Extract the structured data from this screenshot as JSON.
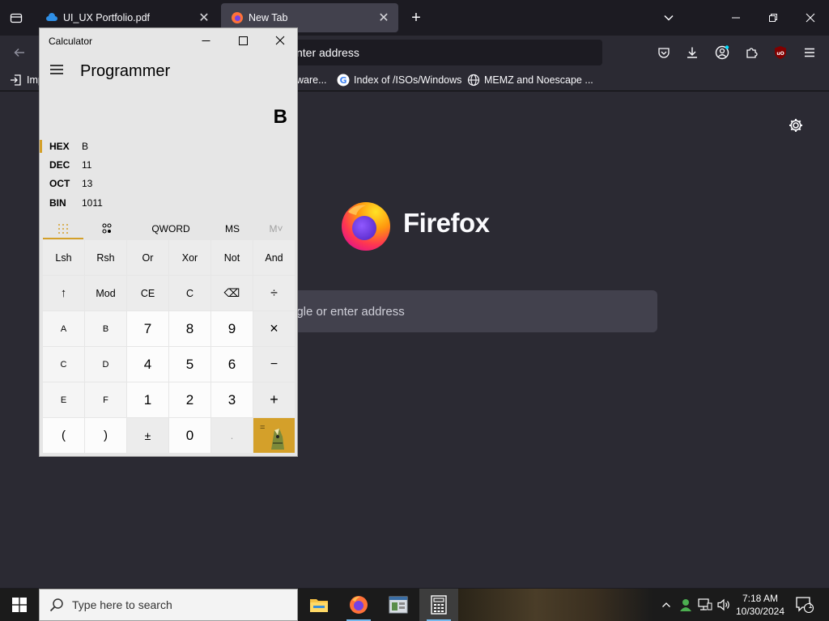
{
  "browser": {
    "tabs": [
      {
        "title": "UI_UX Portfolio.pdf",
        "active": false
      },
      {
        "title": "New Tab",
        "active": true
      }
    ],
    "url_placeholder": "nter address",
    "bookmarks": [
      {
        "label": "Imp",
        "icon": "import-icon"
      },
      {
        "label": "ware...",
        "icon": "folder-icon"
      },
      {
        "label": "Index of /ISOs/Windows",
        "icon": "google-icon"
      },
      {
        "label": "MEMZ and Noescape ...",
        "icon": "globe-icon"
      }
    ],
    "newtab": {
      "brand": "Firefox",
      "search_placeholder": "ogle or enter address"
    }
  },
  "calculator": {
    "window_title": "Calculator",
    "mode": "Programmer",
    "display": "B",
    "radix": [
      {
        "label": "HEX",
        "value": "B",
        "selected": true
      },
      {
        "label": "DEC",
        "value": "11",
        "selected": false
      },
      {
        "label": "OCT",
        "value": "13",
        "selected": false
      },
      {
        "label": "BIN",
        "value": "1011",
        "selected": false
      }
    ],
    "mode_tabs": {
      "word_size": "QWORD",
      "ms": "MS",
      "mplus": "M˅"
    },
    "keys": {
      "row1": [
        "Lsh",
        "Rsh",
        "Or",
        "Xor",
        "Not",
        "And"
      ],
      "row2": [
        "↑",
        "Mod",
        "CE",
        "C",
        "⌫",
        "÷"
      ],
      "row3": [
        "A",
        "B",
        "7",
        "8",
        "9",
        "×"
      ],
      "row4": [
        "C",
        "D",
        "4",
        "5",
        "6",
        "−"
      ],
      "row5": [
        "E",
        "F",
        "1",
        "2",
        "3",
        "+"
      ],
      "row6": [
        "(",
        ")",
        "±",
        "0",
        ".",
        "="
      ]
    }
  },
  "taskbar": {
    "search_placeholder": "Type here to search",
    "time": "7:18 AM",
    "date": "10/30/2024",
    "notification_count": "1"
  },
  "colors": {
    "accent": "#d4a02a",
    "firefox_bg": "#2b2a33",
    "tab_active": "#42414d"
  }
}
